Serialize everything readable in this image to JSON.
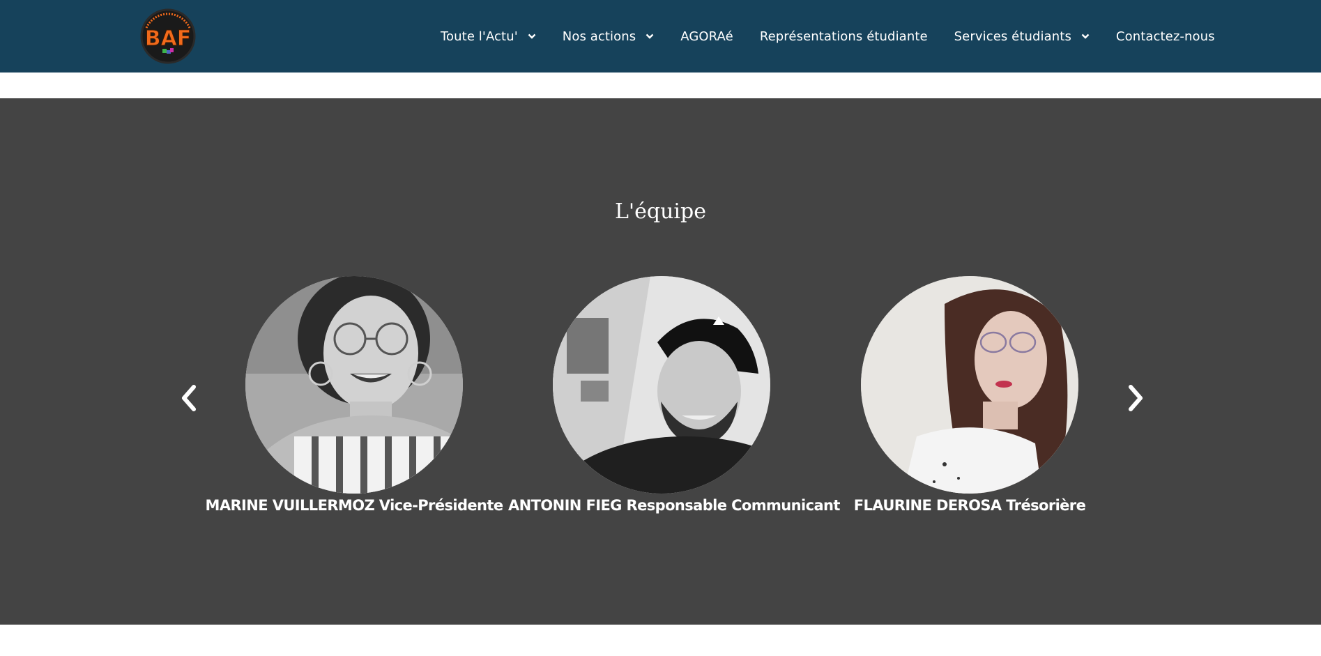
{
  "brand": {
    "logo_text": "BAF",
    "colors": {
      "header_bg": "#16425b",
      "logo_orange": "#f26a1b",
      "section_bg": "#444444"
    }
  },
  "nav": {
    "items": [
      {
        "label": "Toute l'Actu'",
        "has_dropdown": true
      },
      {
        "label": "Nos actions",
        "has_dropdown": true
      },
      {
        "label": "AGORAé",
        "has_dropdown": false
      },
      {
        "label": "Représentations étudiante",
        "has_dropdown": false
      },
      {
        "label": "Services étudiants",
        "has_dropdown": true
      },
      {
        "label": "Contactez-nous",
        "has_dropdown": false
      }
    ]
  },
  "team": {
    "title": "L'équipe",
    "members": [
      {
        "name": "MARINE VUILLERMOZ Vice-Présidente",
        "photo": "avatar-photo-woman-glasses"
      },
      {
        "name": "ANTONIN FIEG Responsable Communicant",
        "photo": "avatar-photo-man-cap"
      },
      {
        "name": "FLAURINE DEROSA Trésorière",
        "photo": "avatar-photo-woman-side"
      }
    ],
    "prev_icon": "chevron-left-icon",
    "next_icon": "chevron-right-icon"
  }
}
